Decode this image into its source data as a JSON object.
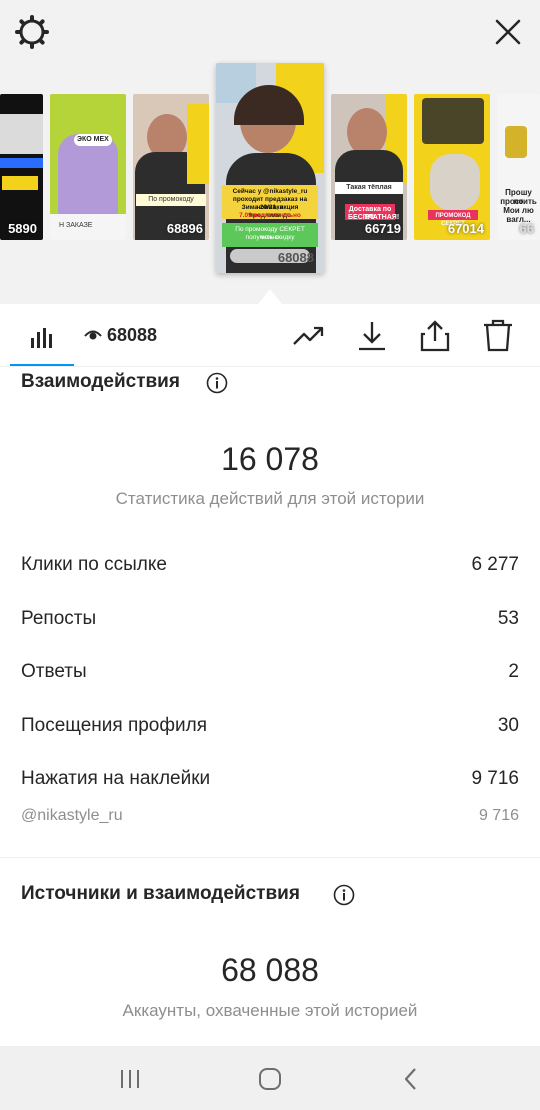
{
  "stories": [
    {
      "count": "5890",
      "caption_lines": [
        "ЭКО МЕХ"
      ]
    },
    {
      "count": "",
      "caption_lines": [
        "ЭКО МЕХ",
        "Н ЗАКАЗЕ"
      ]
    },
    {
      "count": "68896",
      "caption_lines": [
        "По промокоду"
      ]
    },
    {
      "count": "68088",
      "caption_lines": [
        "Сейчас у @nikastyle_ru",
        "проходит предзаказ на новинки",
        "Зима 20/21, акция продлили до",
        "7.09 включительно",
        "По промокоду СЕКРЕТ можно",
        "получить скидку"
      ]
    },
    {
      "count": "66719",
      "caption_lines": [
        "Такая тёплая",
        "Доставка по РФ",
        "БЕСПЛАТНАЯ!"
      ]
    },
    {
      "count": "67014",
      "caption_lines": [
        "ПРОМОКОД СЕКРЕТ"
      ]
    },
    {
      "count": "66",
      "caption_lines": [
        "Прошу по",
        "простить",
        "Мои лю",
        "вагл..."
      ]
    }
  ],
  "toolbar": {
    "reach_count": "68088"
  },
  "interactions": {
    "title": "Взаимодействия",
    "total": "16 078",
    "total_caption": "Статистика действий для этой истории",
    "rows": [
      {
        "label": "Клики по ссылке",
        "value": "6 277"
      },
      {
        "label": "Репосты",
        "value": "53"
      },
      {
        "label": "Ответы",
        "value": "2"
      },
      {
        "label": "Посещения профиля",
        "value": "30"
      },
      {
        "label": "Нажатия на наклейки",
        "value": "9 716"
      }
    ],
    "sticker_sub": {
      "label": "@nikastyle_ru",
      "value": "9 716"
    }
  },
  "sources": {
    "title": "Источники и взаимодействия",
    "total": "68 088",
    "total_caption": "Аккаунты, охваченные этой историей"
  },
  "colors": {
    "accent": "#0095f6",
    "yellow": "#f2d21a",
    "text": "#262626",
    "muted": "#8e8e8e"
  }
}
